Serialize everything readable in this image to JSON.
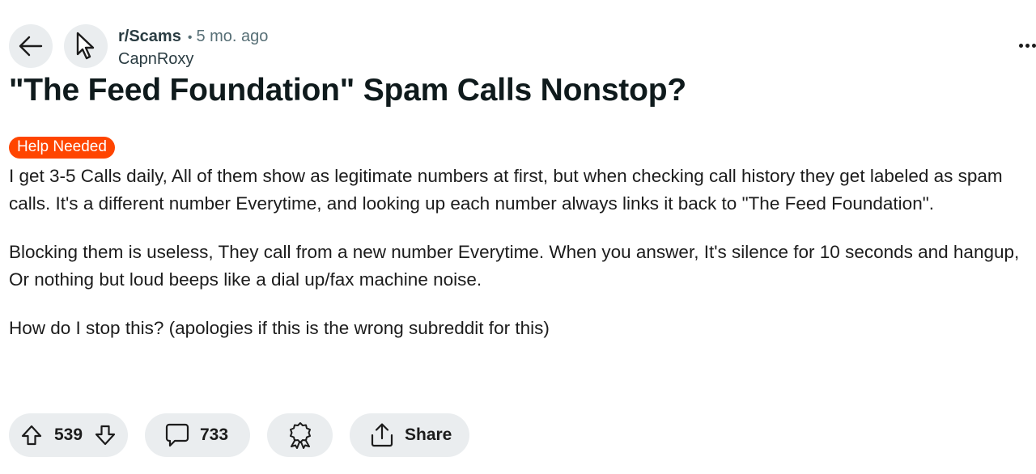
{
  "post": {
    "subreddit": "r/Scams",
    "separator": "•",
    "age": "5 mo. ago",
    "author": "CapnRoxy",
    "title": "\"The Feed Foundation\" Spam Calls Nonstop?",
    "flair": "Help Needed",
    "paragraphs": [
      "I get 3-5 Calls daily, All of them show as legitimate numbers at first, but when checking call history they get labeled as spam calls. It's a different number Everytime, and looking up each number always links it back to \"The Feed Foundation\".",
      "Blocking them is useless, They call from a new number Everytime. When you answer, It's silence for 10 seconds and hangup, Or nothing but loud beeps like a dial up/fax machine noise.",
      "How do I stop this? (apologies if this is the wrong subreddit for this)"
    ]
  },
  "actions": {
    "score": "539",
    "comments": "733",
    "share_label": "Share"
  },
  "icons": {
    "back": "arrow-left-icon",
    "subreddit_avatar": "cursor-pointer-icon",
    "overflow": "more-horizontal-icon",
    "upvote": "upvote-arrow-icon",
    "downvote": "downvote-arrow-icon",
    "comment": "comment-bubble-icon",
    "award": "award-ribbon-icon",
    "share": "share-upload-icon"
  },
  "colors": {
    "flair_bg": "#ff4500",
    "pill_bg": "#eaedef",
    "meta_gray": "#576f76"
  }
}
